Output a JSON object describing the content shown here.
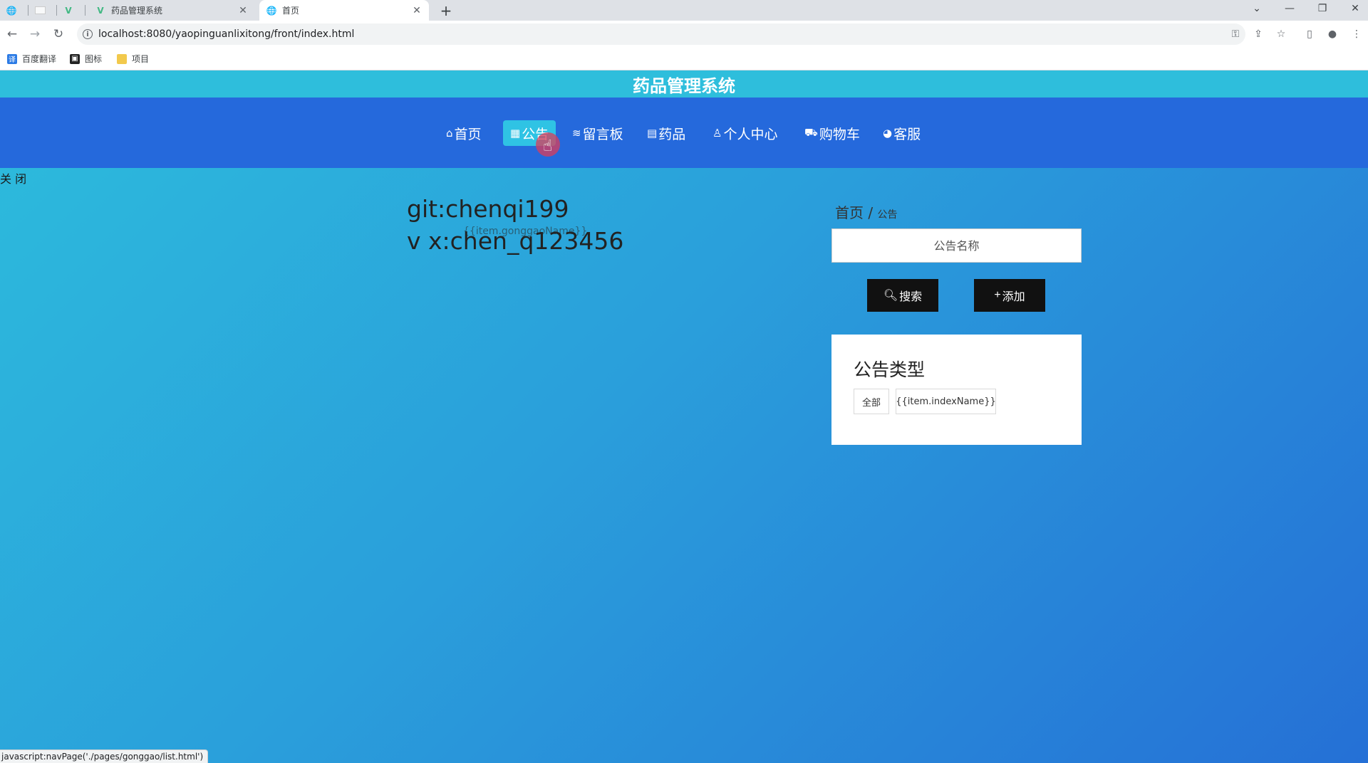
{
  "browser": {
    "tabs": [
      {
        "title": "",
        "icon": "globe-icon"
      },
      {
        "title": "",
        "icon": "blank-icon"
      },
      {
        "title": "",
        "icon": "vue-icon"
      },
      {
        "title": "药品管理系统",
        "icon": "vue-icon"
      },
      {
        "title": "首页",
        "icon": "globe-icon",
        "active": true
      }
    ],
    "url": "localhost:8080/yaopinguanlixitong/front/index.html",
    "bookmarks": [
      {
        "label": "百度翻译",
        "icon": "translate-icon",
        "color": "#2c7be5"
      },
      {
        "label": "图标",
        "icon": "image-icon",
        "color": "#222222"
      },
      {
        "label": "项目",
        "icon": "folder-icon",
        "color": "#f2c94c"
      }
    ],
    "status_text": "javascript:navPage('./pages/gonggao/list.html')"
  },
  "site": {
    "title": "药品管理系统",
    "nav": [
      {
        "label": "首页",
        "icon": "home-icon"
      },
      {
        "label": "公告",
        "icon": "notice-icon",
        "active": true
      },
      {
        "label": "留言板",
        "icon": "message-icon"
      },
      {
        "label": "药品",
        "icon": "medicine-icon"
      },
      {
        "label": "个人中心",
        "icon": "user-icon"
      },
      {
        "label": "购物车",
        "icon": "cart-icon"
      },
      {
        "label": "客服",
        "icon": "service-icon"
      }
    ],
    "close_label": "关 闭"
  },
  "content": {
    "watermark_line1": "git:chenqi199",
    "watermark_line2": "v x:chen_q123456",
    "item_template": "{{item.gonggaoName}}",
    "breadcrumb_home": "首页",
    "breadcrumb_sep": "/",
    "breadcrumb_current": "公告",
    "search_placeholder": "公告名称",
    "search_button": "搜索",
    "add_button": "添加",
    "type_card_title": "公告类型",
    "tag_all": "全部",
    "tag_template": "{{item.indexName}}"
  },
  "colors": {
    "header": "#2ebedc",
    "navbar": "#2569dc",
    "nav_active": "#2fc3e4",
    "button": "#111111"
  }
}
